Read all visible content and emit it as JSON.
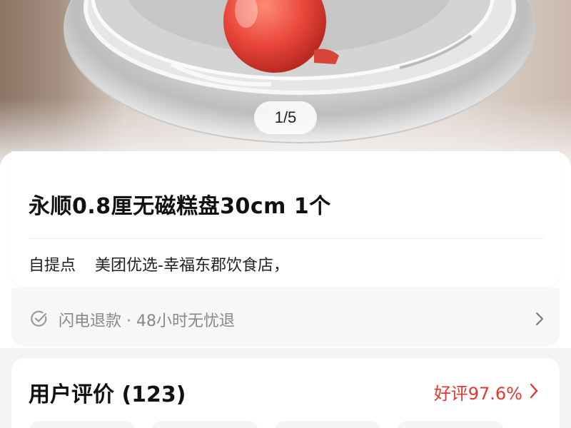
{
  "gallery": {
    "page_indicator": "1/5",
    "image_subject": "stainless steel tray with tomato"
  },
  "product": {
    "title": "永顺0.8厘无磁糕盘30cm 1个"
  },
  "pickup": {
    "label": "自提点",
    "value": "美团优选-幸福东郡饮食店，"
  },
  "service": {
    "icon": "check-circle-icon",
    "text": "闪电退款 · 48小时无忧退",
    "arrow_icon": "chevron-right-icon"
  },
  "reviews": {
    "title": "用户评价 (123)",
    "positive_rate": "好评97.6%",
    "arrow_icon": "chevron-right-icon"
  },
  "colors": {
    "accent_red": "#e2382d",
    "text_primary": "#111111",
    "text_secondary": "#888888",
    "background": "#f4f4f4"
  }
}
